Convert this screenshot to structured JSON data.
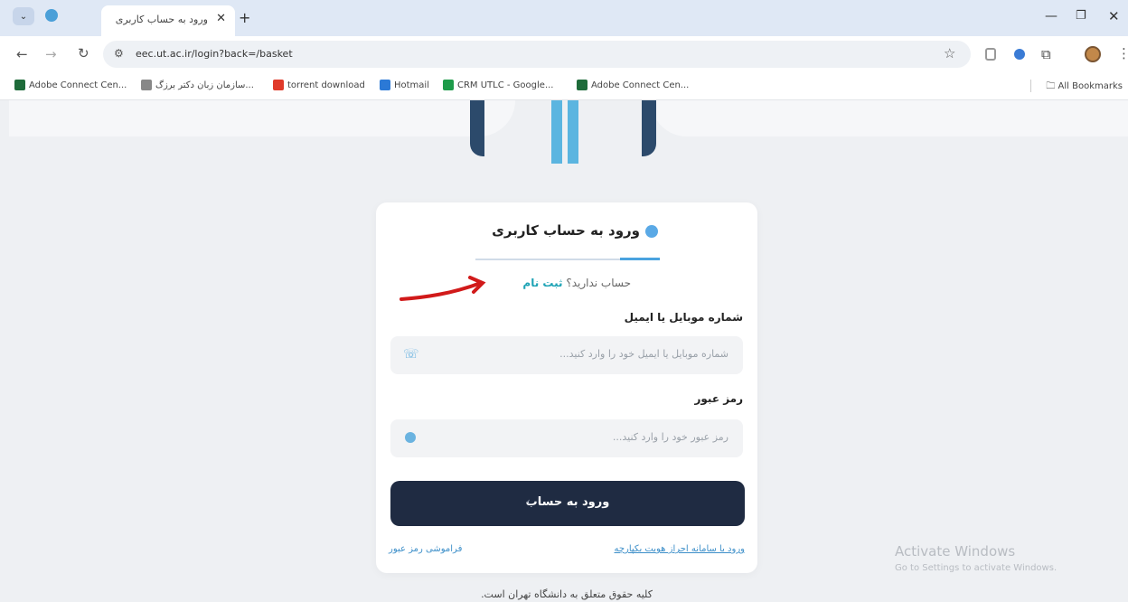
{
  "browser": {
    "tab_title": "ورود به حساب کاربری",
    "url": "eec.ut.ac.ir/login?back=/basket",
    "bookmarks": [
      {
        "label": "Adobe Connect Cen...",
        "color": "#1e6b3a"
      },
      {
        "label": "سازمان زبان دکتر برزگ...",
        "color": "#888888"
      },
      {
        "label": "torrent download",
        "color": "#e03a2a"
      },
      {
        "label": "Hotmail",
        "color": "#2b79d6"
      },
      {
        "label": "CRM UTLC - Google...",
        "color": "#1e9b4a"
      },
      {
        "label": "Adobe Connect Cen...",
        "color": "#1e6b3a"
      }
    ],
    "all_bookmarks": "All Bookmarks"
  },
  "login": {
    "title": "ورود به حساب کاربری",
    "no_account": "حساب ندارید؟",
    "signup": "ثبت نام",
    "mobile_label": "شماره موبایل یا ایمیل",
    "mobile_placeholder": "شماره موبایل یا ایمیل خود را وارد کنید...",
    "password_label": "رمز عبور",
    "password_placeholder": "رمز عبور خود را وارد کنید...",
    "submit": "ورود به حساب",
    "forgot": "فراموشی رمز عبور",
    "sso": "ورود با سامانه احراز هویت یکپارچه"
  },
  "footer": "کلیه حقوق متعلق به دانشگاه تهران است.",
  "watermark": {
    "title": "Activate Windows",
    "subtitle": "Go to Settings to activate Windows."
  },
  "colors": {
    "accent": "#1ea3b5",
    "button": "#1f2b42",
    "annotation": "#d11a1a"
  }
}
